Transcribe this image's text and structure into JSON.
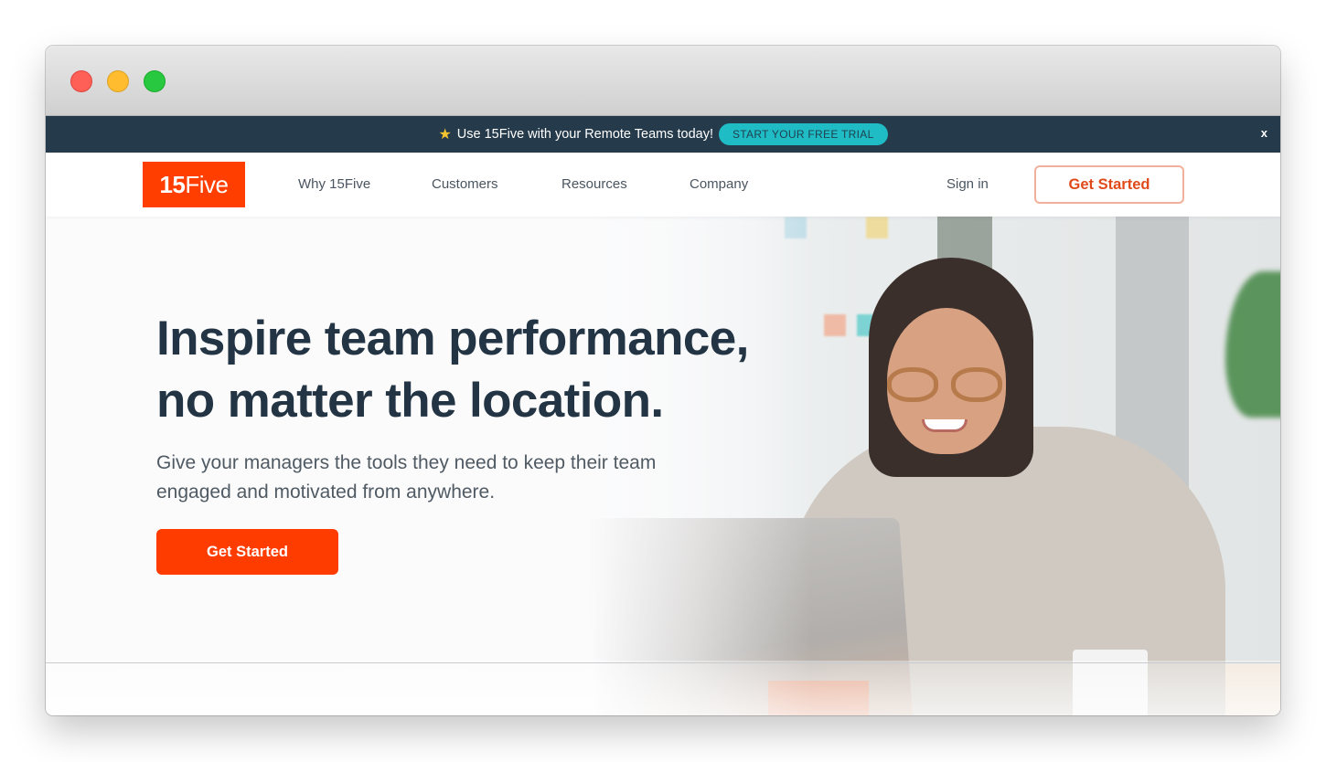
{
  "window": {
    "controls": [
      "close",
      "minimize",
      "maximize"
    ]
  },
  "promo_bar": {
    "icon": "star-icon",
    "star_glyph": "★",
    "message": "Use 15Five with your Remote Teams today!",
    "cta_label": "START YOUR FREE TRIAL",
    "close_label": "x"
  },
  "nav": {
    "logo": {
      "bold": "15",
      "light": "Five"
    },
    "links": [
      {
        "label": "Why 15Five"
      },
      {
        "label": "Customers"
      },
      {
        "label": "Resources"
      },
      {
        "label": "Company"
      }
    ],
    "sign_in_label": "Sign in",
    "cta_label": "Get Started"
  },
  "hero": {
    "title_line1": "Inspire team performance,",
    "title_line2": "no matter the location.",
    "subtitle": "Give your managers the tools they need to keep their team engaged and motivated from anywhere.",
    "cta_label": "Get Started"
  },
  "colors": {
    "brand_orange": "#ff3e00",
    "promo_bg": "#253a4a",
    "promo_cta": "#1fbcc6",
    "heading": "#233544"
  }
}
